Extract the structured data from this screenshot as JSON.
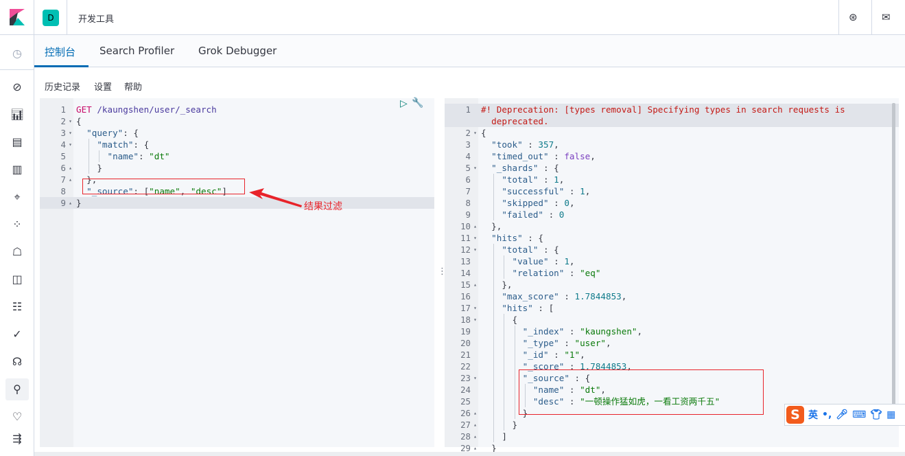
{
  "header": {
    "space_letter": "D",
    "breadcrumb": "开发工具",
    "help_icon": "lifebuoy-icon",
    "mail_icon": "mail-icon"
  },
  "nav": {
    "icons": [
      "clock-icon",
      "compass-icon",
      "visualize-icon",
      "dashboard-icon",
      "canvas-icon",
      "maps-icon",
      "ml-icon",
      "metrics-icon",
      "logs-icon",
      "apm-icon",
      "uptime-icon",
      "siem-icon",
      "devtools-icon",
      "monitoring-icon",
      "collapse-icon"
    ]
  },
  "tabs": [
    {
      "label": "控制台",
      "active": true
    },
    {
      "label": "Search Profiler"
    },
    {
      "label": "Grok Debugger"
    }
  ],
  "menu": [
    "历史记录",
    "设置",
    "帮助"
  ],
  "request_lines": [
    [
      [
        "m",
        "GET"
      ],
      [
        "u",
        " /kaungshen/user/_search"
      ]
    ],
    [
      [
        "p",
        "{"
      ]
    ],
    [
      [
        "p",
        "  "
      ],
      [
        "k",
        "\"query\""
      ],
      [
        "p",
        ": {"
      ]
    ],
    [
      [
        "p",
        "    "
      ],
      [
        "k",
        "\"match\""
      ],
      [
        "p",
        ": {"
      ]
    ],
    [
      [
        "p",
        "      "
      ],
      [
        "k",
        "\"name\""
      ],
      [
        "p",
        ": "
      ],
      [
        "s",
        "\"dt\""
      ]
    ],
    [
      [
        "p",
        "    }"
      ]
    ],
    [
      [
        "p",
        "  },"
      ]
    ],
    [
      [
        "p",
        "  "
      ],
      [
        "k",
        "\"_source\""
      ],
      [
        "p",
        ": ["
      ],
      [
        "s",
        "\"name\""
      ],
      [
        "p",
        ", "
      ],
      [
        "s",
        "\"desc\""
      ],
      [
        "p",
        "]"
      ]
    ],
    [
      [
        "p",
        "}"
      ]
    ]
  ],
  "request_folds": [
    "",
    "▾",
    "▾",
    "▾",
    "",
    "▴",
    "▴",
    "",
    "▴"
  ],
  "response_lines": [
    [
      [
        "w",
        "#! Deprecation: [types removal] Specifying types in search requests is"
      ]
    ],
    [
      [
        "w",
        "  deprecated."
      ]
    ],
    [
      [
        "p",
        "{"
      ]
    ],
    [
      [
        "p",
        "  "
      ],
      [
        "k",
        "\"took\""
      ],
      [
        "p",
        " : "
      ],
      [
        "n",
        "357"
      ],
      [
        "p",
        ","
      ]
    ],
    [
      [
        "p",
        "  "
      ],
      [
        "k",
        "\"timed_out\""
      ],
      [
        "p",
        " : "
      ],
      [
        "b",
        "false"
      ],
      [
        "p",
        ","
      ]
    ],
    [
      [
        "p",
        "  "
      ],
      [
        "k",
        "\"_shards\""
      ],
      [
        "p",
        " : {"
      ]
    ],
    [
      [
        "p",
        "    "
      ],
      [
        "k",
        "\"total\""
      ],
      [
        "p",
        " : "
      ],
      [
        "n",
        "1"
      ],
      [
        "p",
        ","
      ]
    ],
    [
      [
        "p",
        "    "
      ],
      [
        "k",
        "\"successful\""
      ],
      [
        "p",
        " : "
      ],
      [
        "n",
        "1"
      ],
      [
        "p",
        ","
      ]
    ],
    [
      [
        "p",
        "    "
      ],
      [
        "k",
        "\"skipped\""
      ],
      [
        "p",
        " : "
      ],
      [
        "n",
        "0"
      ],
      [
        "p",
        ","
      ]
    ],
    [
      [
        "p",
        "    "
      ],
      [
        "k",
        "\"failed\""
      ],
      [
        "p",
        " : "
      ],
      [
        "n",
        "0"
      ]
    ],
    [
      [
        "p",
        "  },"
      ]
    ],
    [
      [
        "p",
        "  "
      ],
      [
        "k",
        "\"hits\""
      ],
      [
        "p",
        " : {"
      ]
    ],
    [
      [
        "p",
        "    "
      ],
      [
        "k",
        "\"total\""
      ],
      [
        "p",
        " : {"
      ]
    ],
    [
      [
        "p",
        "      "
      ],
      [
        "k",
        "\"value\""
      ],
      [
        "p",
        " : "
      ],
      [
        "n",
        "1"
      ],
      [
        "p",
        ","
      ]
    ],
    [
      [
        "p",
        "      "
      ],
      [
        "k",
        "\"relation\""
      ],
      [
        "p",
        " : "
      ],
      [
        "s",
        "\"eq\""
      ]
    ],
    [
      [
        "p",
        "    },"
      ]
    ],
    [
      [
        "p",
        "    "
      ],
      [
        "k",
        "\"max_score\""
      ],
      [
        "p",
        " : "
      ],
      [
        "n",
        "1.7844853"
      ],
      [
        "p",
        ","
      ]
    ],
    [
      [
        "p",
        "    "
      ],
      [
        "k",
        "\"hits\""
      ],
      [
        "p",
        " : ["
      ]
    ],
    [
      [
        "p",
        "      {"
      ]
    ],
    [
      [
        "p",
        "        "
      ],
      [
        "k",
        "\"_index\""
      ],
      [
        "p",
        " : "
      ],
      [
        "s",
        "\"kaungshen\""
      ],
      [
        "p",
        ","
      ]
    ],
    [
      [
        "p",
        "        "
      ],
      [
        "k",
        "\"_type\""
      ],
      [
        "p",
        " : "
      ],
      [
        "s",
        "\"user\""
      ],
      [
        "p",
        ","
      ]
    ],
    [
      [
        "p",
        "        "
      ],
      [
        "k",
        "\"_id\""
      ],
      [
        "p",
        " : "
      ],
      [
        "s",
        "\"1\""
      ],
      [
        "p",
        ","
      ]
    ],
    [
      [
        "p",
        "        "
      ],
      [
        "k",
        "\"_score\""
      ],
      [
        "p",
        " : "
      ],
      [
        "n",
        "1.7844853"
      ],
      [
        "p",
        ","
      ]
    ],
    [
      [
        "p",
        "        "
      ],
      [
        "k",
        "\"_source\""
      ],
      [
        "p",
        " : {"
      ]
    ],
    [
      [
        "p",
        "          "
      ],
      [
        "k",
        "\"name\""
      ],
      [
        "p",
        " : "
      ],
      [
        "s",
        "\"dt\""
      ],
      [
        "p",
        ","
      ]
    ],
    [
      [
        "p",
        "          "
      ],
      [
        "k",
        "\"desc\""
      ],
      [
        "p",
        " : "
      ],
      [
        "s",
        "\"一顿操作猛如虎，一看工资两千五\""
      ]
    ],
    [
      [
        "p",
        "        }"
      ]
    ],
    [
      [
        "p",
        "      }"
      ]
    ],
    [
      [
        "p",
        "    ]"
      ]
    ],
    [
      [
        "p",
        "  }"
      ]
    ]
  ],
  "response_numbers": [
    "1",
    "",
    "2",
    "3",
    "4",
    "5",
    "6",
    "7",
    "8",
    "9",
    "10",
    "11",
    "12",
    "13",
    "14",
    "15",
    "16",
    "17",
    "18",
    "19",
    "20",
    "21",
    "22",
    "23",
    "24",
    "25",
    "26",
    "27",
    "28",
    "29"
  ],
  "response_folds": [
    "",
    "",
    "▾",
    "",
    "",
    "▾",
    "",
    "",
    "",
    "",
    "▴",
    "▾",
    "▾",
    "",
    "",
    "▴",
    "",
    "▾",
    "▾",
    "",
    "",
    "",
    "",
    "▾",
    "",
    "",
    "▴",
    "▴",
    "▴",
    "▴"
  ],
  "annotation": {
    "text": "结果过滤",
    "color": "#e8232a"
  },
  "ime": {
    "lang": "英",
    "punct": "•,"
  },
  "colors": {
    "accent": "#006bb4",
    "space_badge": "#00bfb3",
    "annotation": "#e8232a"
  }
}
